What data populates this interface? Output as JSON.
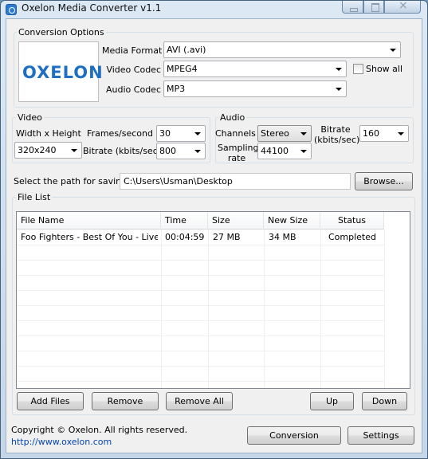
{
  "window": {
    "title": "Oxelon Media Converter v1.1"
  },
  "conversion_options": {
    "legend": "Conversion Options",
    "logo_text": "OXELON",
    "media_format_label": "Media Format",
    "media_format_value": "AVI (.avi)",
    "video_codec_label": "Video Codec",
    "video_codec_value": "MPEG4",
    "audio_codec_label": "Audio Codec",
    "audio_codec_value": "MP3",
    "show_all_label": "Show all",
    "show_all_checked": false
  },
  "video": {
    "legend": "Video",
    "size_label": "Width x Height",
    "size_value": "320x240",
    "fps_label": "Frames/second",
    "fps_value": "30",
    "bitrate_label": "Bitrate (kbits/sec)",
    "bitrate_value": "800"
  },
  "audio": {
    "legend": "Audio",
    "channels_label": "Channels",
    "channels_value": "Stereo",
    "sampling_label_1": "Sampling",
    "sampling_label_2": "rate",
    "sampling_value": "44100",
    "bitrate_label_1": "Bitrate",
    "bitrate_label_2": "(kbits/sec)",
    "bitrate_value": "160"
  },
  "save_path": {
    "label": "Select the path for saving:",
    "value": "C:\\Users\\Usman\\Desktop",
    "browse_label": "Browse..."
  },
  "file_list": {
    "legend": "File List",
    "columns": [
      "File Name",
      "Time",
      "Size",
      "New Size",
      "Status"
    ],
    "rows": [
      {
        "name": "Foo Fighters - Best Of You - Live…",
        "time": "00:04:59",
        "size": "27 MB",
        "new_size": "34 MB",
        "status": "Completed"
      }
    ],
    "buttons": {
      "add": "Add Files",
      "remove": "Remove",
      "remove_all": "Remove All",
      "up": "Up",
      "down": "Down"
    }
  },
  "footer": {
    "copyright": "Copyright © Oxelon. All rights reserved.",
    "link": "http://www.oxelon.com",
    "conversion_label": "Conversion",
    "settings_label": "Settings"
  },
  "colors": {
    "logo": "#1e6fc4",
    "link": "#0645ad",
    "titlebar": "#c5d6e8"
  }
}
